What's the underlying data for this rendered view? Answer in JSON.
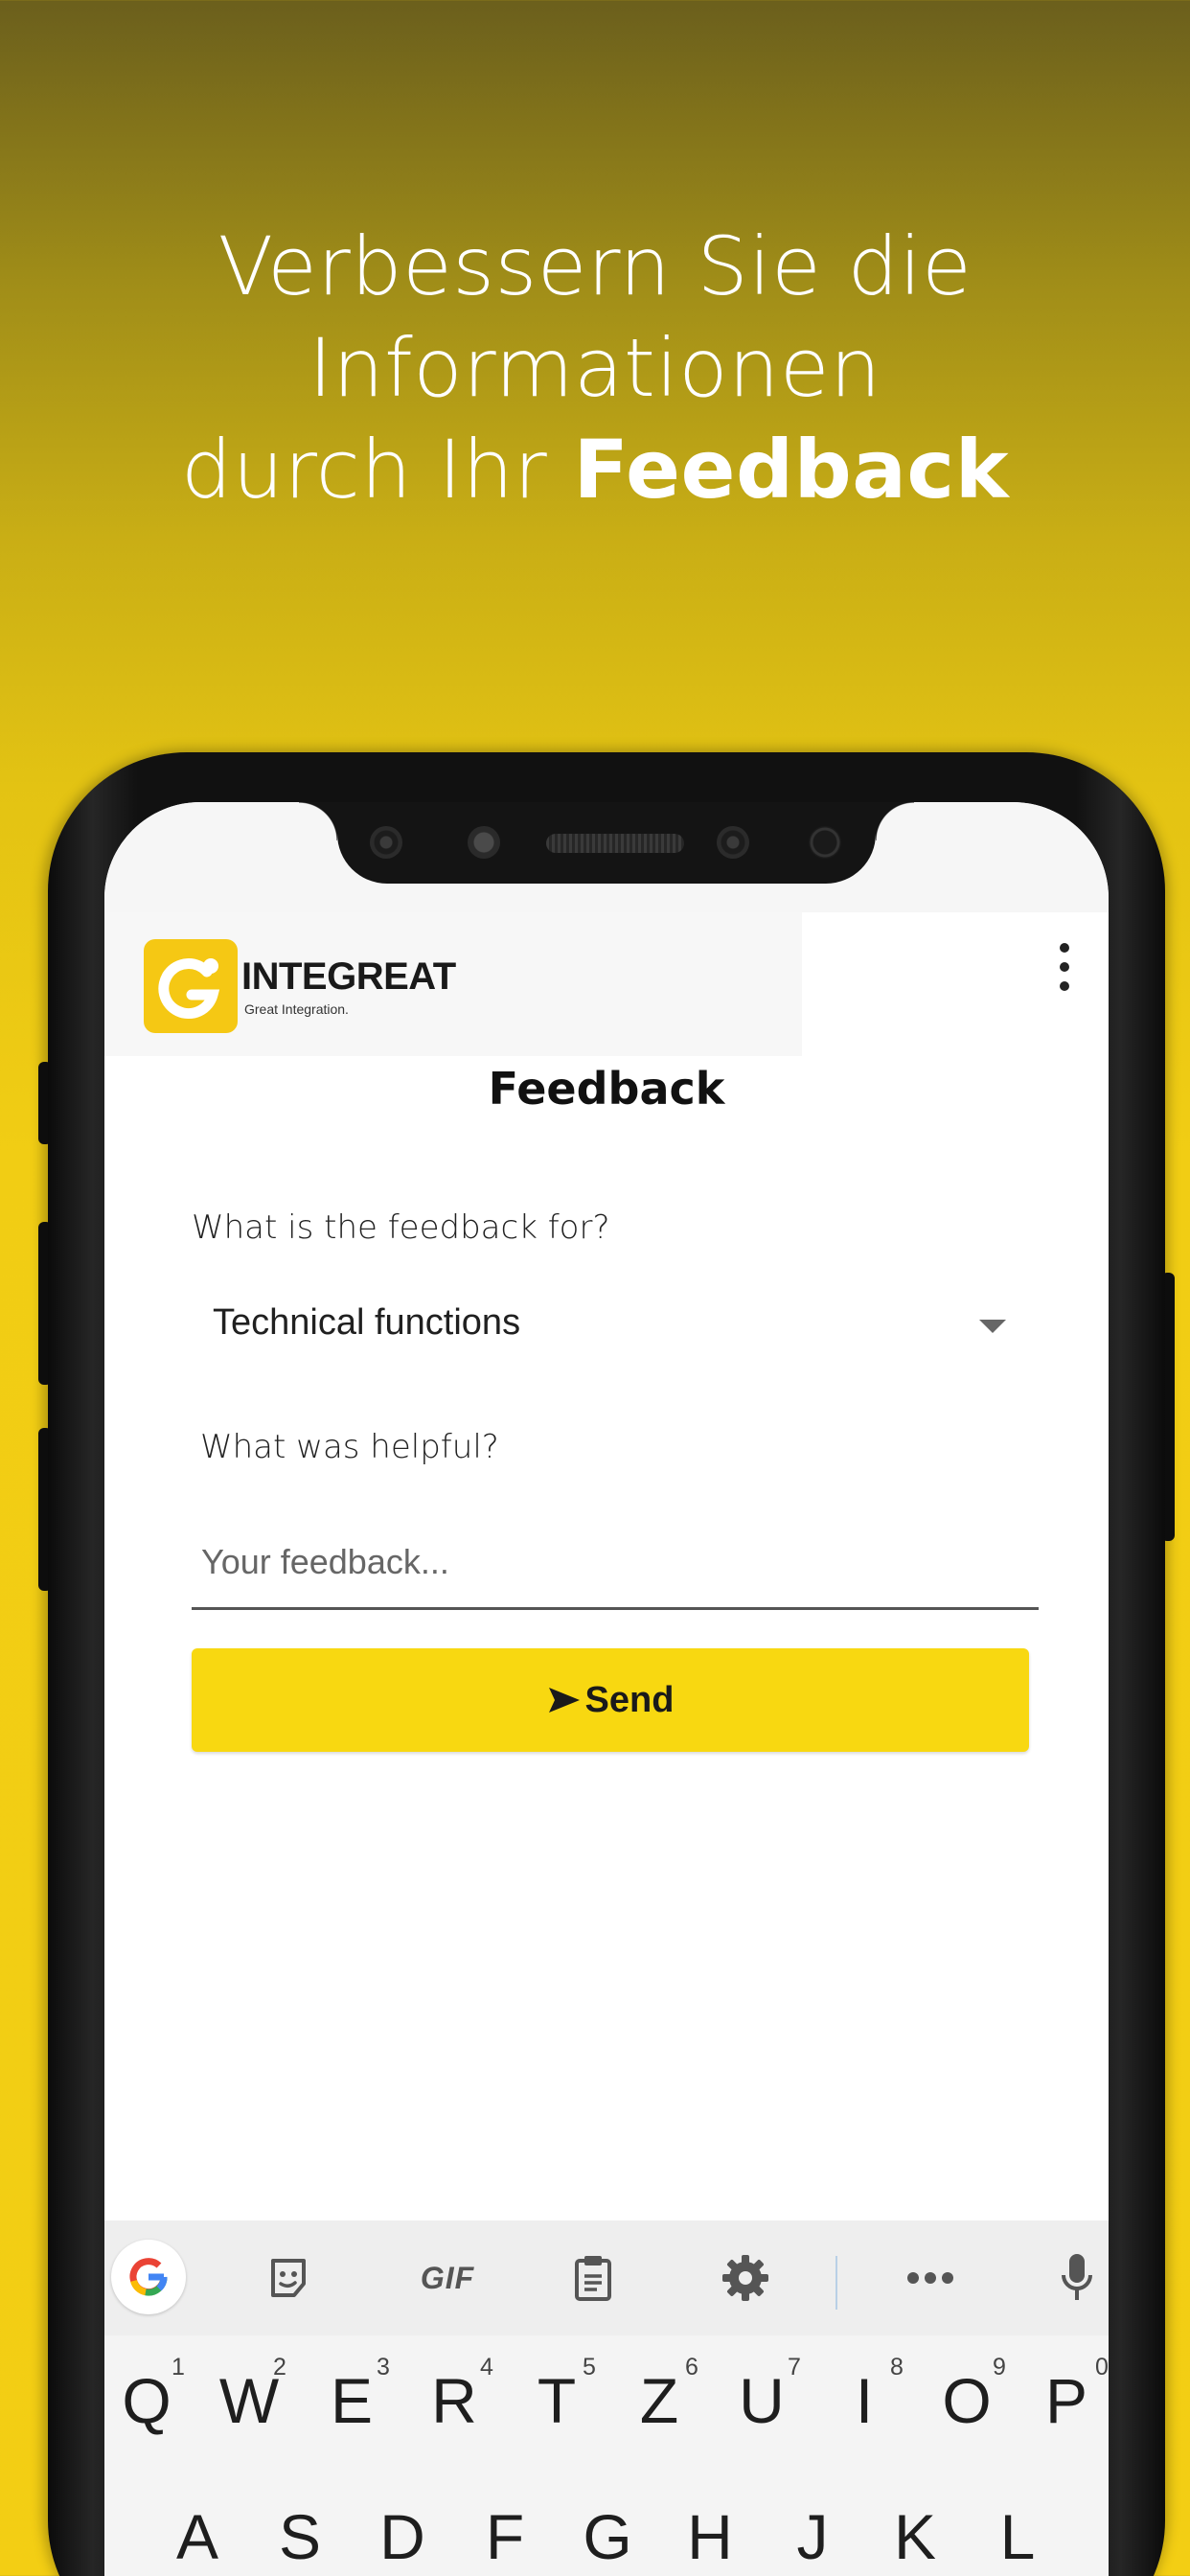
{
  "headline": {
    "line1": "Verbessern Sie die",
    "line2": "Informationen",
    "line3_regular": "durch Ihr ",
    "line3_bold": "Feedback"
  },
  "app": {
    "brand": "INTEGREAT",
    "tagline": "Great Integration."
  },
  "form": {
    "title": "Feedback",
    "question1": "What is the feedback for?",
    "selected_option": "Technical functions",
    "question2": "What was helpful?",
    "input_placeholder": "Your feedback...",
    "input_value": "",
    "send_label": "Send"
  },
  "keyboard": {
    "toolbar": {
      "gif_label": "GIF"
    },
    "row1": [
      {
        "key": "Q",
        "num": "1"
      },
      {
        "key": "W",
        "num": "2"
      },
      {
        "key": "E",
        "num": "3"
      },
      {
        "key": "R",
        "num": "4"
      },
      {
        "key": "T",
        "num": "5"
      },
      {
        "key": "Z",
        "num": "6"
      },
      {
        "key": "U",
        "num": "7"
      },
      {
        "key": "I",
        "num": "8"
      },
      {
        "key": "O",
        "num": "9"
      },
      {
        "key": "P",
        "num": "0"
      }
    ],
    "row2": [
      "A",
      "S",
      "D",
      "F",
      "G",
      "H",
      "J",
      "K",
      "L"
    ]
  },
  "colors": {
    "accent_yellow": "#f8d811",
    "logo_yellow": "#f5c814",
    "background_top": "#6b5f1c",
    "background_bottom": "#f3ce14"
  }
}
